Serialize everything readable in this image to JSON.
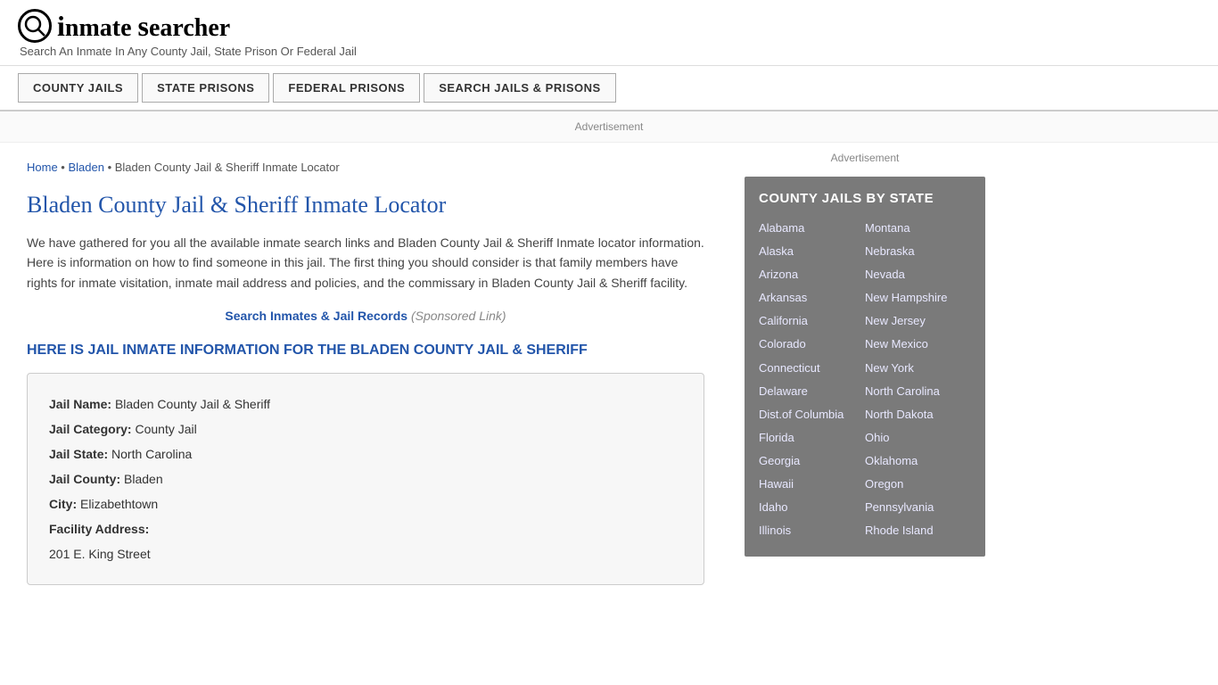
{
  "header": {
    "logo_icon": "Q",
    "logo_text": "inmate searcher",
    "tagline": "Search An Inmate In Any County Jail, State Prison Or Federal Jail"
  },
  "nav": {
    "items": [
      {
        "label": "COUNTY JAILS",
        "href": "#"
      },
      {
        "label": "STATE PRISONS",
        "href": "#"
      },
      {
        "label": "FEDERAL PRISONS",
        "href": "#"
      },
      {
        "label": "SEARCH JAILS & PRISONS",
        "href": "#"
      }
    ]
  },
  "ad_banner": "Advertisement",
  "breadcrumb": {
    "home": "Home",
    "parent": "Bladen",
    "current": "Bladen County Jail & Sheriff Inmate Locator"
  },
  "page_title": "Bladen County Jail & Sheriff Inmate Locator",
  "description": "We have gathered for you all the available inmate search links and Bladen County Jail & Sheriff Inmate locator information. Here is information on how to find someone in this jail. The first thing you should consider is that family members have rights for inmate visitation, inmate mail address and policies, and the commissary in Bladen County Jail & Sheriff facility.",
  "sponsored": {
    "link_text": "Search Inmates & Jail Records",
    "tag": "(Sponsored Link)"
  },
  "info_section_title": "HERE IS JAIL INMATE INFORMATION FOR THE BLADEN COUNTY JAIL & SHERIFF",
  "info_card": {
    "fields": [
      {
        "label": "Jail Name:",
        "value": "Bladen County Jail & Sheriff"
      },
      {
        "label": "Jail Category:",
        "value": "County Jail"
      },
      {
        "label": "Jail State:",
        "value": "North Carolina"
      },
      {
        "label": "Jail County:",
        "value": "Bladen"
      },
      {
        "label": "City:",
        "value": "Elizabethtown"
      },
      {
        "label": "Facility Address:",
        "value": ""
      },
      {
        "label": "",
        "value": "201 E. King Street"
      }
    ]
  },
  "sidebar": {
    "ad_label": "Advertisement",
    "state_box_title": "COUNTY JAILS BY STATE",
    "states_left": [
      "Alabama",
      "Alaska",
      "Arizona",
      "Arkansas",
      "California",
      "Colorado",
      "Connecticut",
      "Delaware",
      "Dist.of Columbia",
      "Florida",
      "Georgia",
      "Hawaii",
      "Idaho",
      "Illinois"
    ],
    "states_right": [
      "Montana",
      "Nebraska",
      "Nevada",
      "New Hampshire",
      "New Jersey",
      "New Mexico",
      "New York",
      "North Carolina",
      "North Dakota",
      "Ohio",
      "Oklahoma",
      "Oregon",
      "Pennsylvania",
      "Rhode Island"
    ]
  }
}
